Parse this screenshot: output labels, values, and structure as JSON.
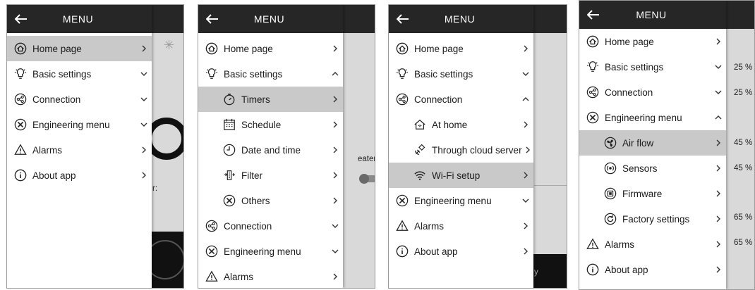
{
  "menu_title": "MENU",
  "labels": {
    "home": "Home page",
    "basic": "Basic settings",
    "connection": "Connection",
    "engineering": "Engineering menu",
    "alarms": "Alarms",
    "about": "About app",
    "timers": "Timers",
    "schedule": "Schedule",
    "datetime": "Date and time",
    "filter": "Filter",
    "others": "Others",
    "at_home": "At home",
    "cloud": "Through cloud server",
    "wifi": "Wi-Fi setup",
    "air_flow": "Air flow",
    "sensors": "Sensors",
    "firmware": "Firmware",
    "factory": "Factory settings"
  },
  "background": {
    "screen2_text": "eater:",
    "screen1_text": "r:",
    "screen3_text": "y",
    "percentages": [
      "25 %",
      "25 %",
      "45 %",
      "45 %",
      "65 %",
      "65 %"
    ]
  }
}
